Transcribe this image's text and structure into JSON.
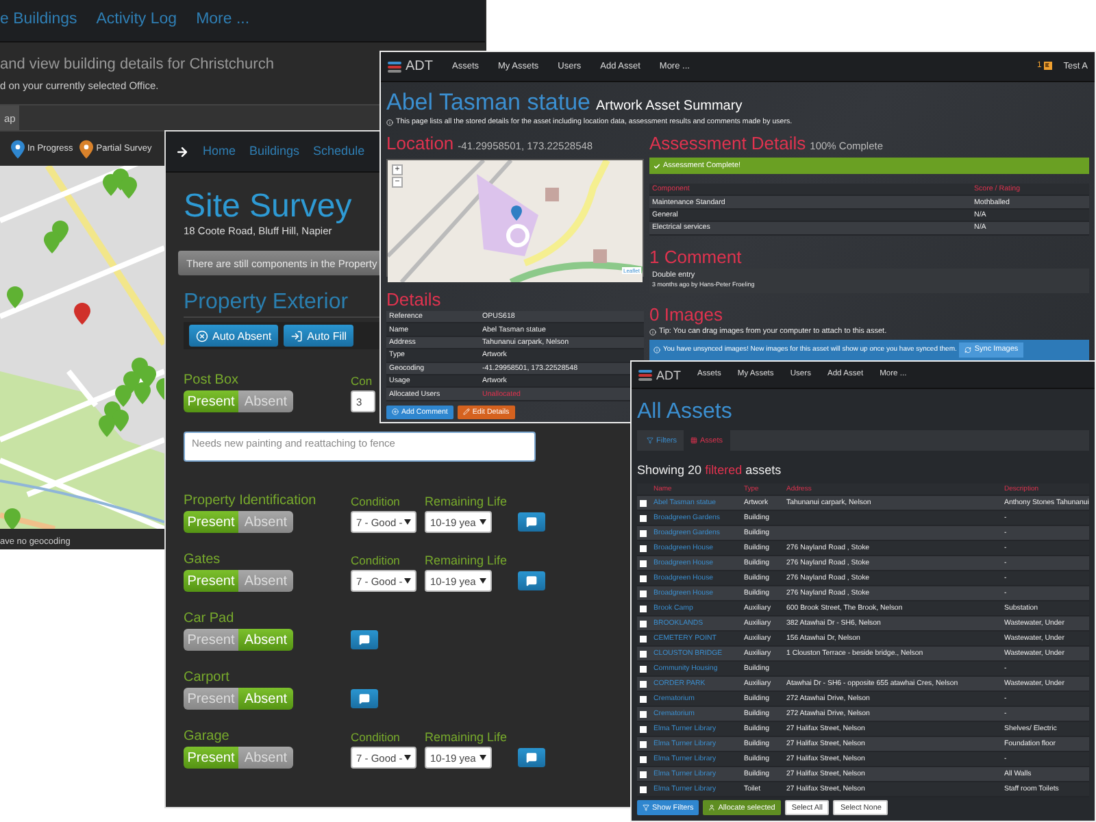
{
  "back_window": {
    "nav": [
      "e Buildings",
      "Activity Log",
      "More ..."
    ],
    "heading": "and view building details for Christchurch",
    "subheading": "d on your currently selected Office.",
    "tab": {
      "label": "ap",
      "selected": true
    },
    "legend": [
      {
        "label": "In Progress",
        "color": "#2f87d0"
      },
      {
        "label": "Partial Survey",
        "color": "#d9822b"
      }
    ],
    "footer": "ave no geocoding"
  },
  "site_survey": {
    "nav": [
      "Home",
      "Buildings",
      "Schedule"
    ],
    "title": "Site Survey",
    "address": "18 Coote Road, Bluff Hill, Napier",
    "alert": "There are still components in the Property",
    "section": "Property Exterior",
    "actions": [
      "Auto Absent",
      "Auto Fill"
    ],
    "components": [
      {
        "label": "Post Box",
        "options": [
          {
            "label": "Present",
            "selected": true
          },
          {
            "label": "Absent",
            "selected": false
          }
        ],
        "condition": {
          "label": "Con",
          "value": "3"
        },
        "notes": "Needs new painting and reattaching to fence",
        "comment": false
      },
      {
        "label": "Property Identification",
        "options": [
          {
            "label": "Present",
            "selected": true
          },
          {
            "label": "Absent",
            "selected": false
          }
        ],
        "condition": {
          "label": "Condition",
          "value": "7 - Good -"
        },
        "remaining_life": {
          "label": "Remaining Life",
          "value": "10-19 yea"
        },
        "comment": true
      },
      {
        "label": "Gates",
        "options": [
          {
            "label": "Present",
            "selected": true
          },
          {
            "label": "Absent",
            "selected": false
          }
        ],
        "condition": {
          "label": "Condition",
          "value": "7 - Good -"
        },
        "remaining_life": {
          "label": "Remaining Life",
          "value": "10-19 yea"
        },
        "comment": true
      },
      {
        "label": "Car Pad",
        "options": [
          {
            "label": "Present",
            "selected": false
          },
          {
            "label": "Absent",
            "selected": true
          }
        ],
        "comment": true
      },
      {
        "label": "Carport",
        "options": [
          {
            "label": "Present",
            "selected": false
          },
          {
            "label": "Absent",
            "selected": true
          }
        ],
        "comment": true
      },
      {
        "label": "Garage",
        "options": [
          {
            "label": "Present",
            "selected": true
          },
          {
            "label": "Absent",
            "selected": false
          }
        ],
        "condition": {
          "label": "Condition",
          "value": "7 - Good -"
        },
        "remaining_life": {
          "label": "Remaining Life",
          "value": "10-19 yea"
        },
        "comment": true
      }
    ]
  },
  "asset_summary": {
    "brand": "ADT",
    "nav": [
      "Assets",
      "My Assets",
      "Users",
      "Add Asset",
      "More ..."
    ],
    "notifications": "1",
    "user": "Test A",
    "title": "Abel Tasman statue",
    "subtitle": "Artwork Asset Summary",
    "info": "This page lists all the stored details for the asset including location data, assessment results and comments made by users.",
    "location": {
      "heading": "Location",
      "coords": "-41.29958501, 173.22528548",
      "zoom": [
        "+",
        "−"
      ],
      "attribution": "Leaflet"
    },
    "details": {
      "heading": "Details",
      "rows": [
        {
          "label": "Reference",
          "value": "OPUS618",
          "highlight": false
        },
        {
          "label": "Name",
          "value": "Abel Tasman statue",
          "highlight": false
        },
        {
          "label": "Address",
          "value": "Tahunanui carpark, Nelson",
          "highlight": false
        },
        {
          "label": "Type",
          "value": "Artwork",
          "highlight": false
        },
        {
          "label": "Geocoding",
          "value": "-41.29958501, 173.22528548",
          "highlight": false
        },
        {
          "label": "Usage",
          "value": "Artwork",
          "highlight": false
        },
        {
          "label": "Allocated Users",
          "value": "Unallocated",
          "highlight": true
        }
      ]
    },
    "buttons": [
      {
        "label": "Add Comment",
        "kind": "primary"
      },
      {
        "label": "Edit Details",
        "kind": "warning"
      }
    ],
    "assessment": {
      "heading": "Assessment Details",
      "progress": "100% Complete",
      "banner": "Assessment Complete!",
      "columns": [
        "Component",
        "Score / Rating"
      ],
      "rows": [
        [
          "Maintenance Standard",
          "Mothballed"
        ],
        [
          "General",
          "N/A"
        ],
        [
          "Electrical services",
          "N/A"
        ]
      ]
    },
    "comments": {
      "heading": "1 Comment",
      "items": [
        {
          "text": "Double entry",
          "meta": "3 months ago by Hans-Peter Froeling"
        }
      ]
    },
    "images": {
      "heading": "0 Images",
      "tip": "Tip: You can drag images from your computer to attach to this asset.",
      "alert": "You have unsynced images! New images for this asset will show up once you have synced them.",
      "sync_button": "Sync Images"
    }
  },
  "all_assets": {
    "brand": "ADT",
    "nav": [
      "Assets",
      "My Assets",
      "Users",
      "Add Asset",
      "More ..."
    ],
    "title": "All Assets",
    "tabs": [
      {
        "label": "Filters",
        "selected": false
      },
      {
        "label": "Assets",
        "selected": true
      }
    ],
    "summary": {
      "before": "Showing 20",
      "highlight": "filtered",
      "after": "assets"
    },
    "columns": [
      "Name",
      "Type",
      "Address",
      "Description"
    ],
    "rows": [
      {
        "checked": false,
        "name": "Abel Tasman statue",
        "type": "Artwork",
        "address": "Tahunanui carpark, Nelson",
        "description": "Anthony Stones Tahunanui"
      },
      {
        "checked": false,
        "name": "Broadgreen Gardens",
        "type": "Building",
        "description": "-"
      },
      {
        "checked": false,
        "name": "Broadgreen Gardens",
        "type": "Building",
        "description": "-"
      },
      {
        "checked": false,
        "name": "Broadgreen House",
        "type": "Building",
        "address": "276 Nayland Road , Stoke",
        "description": "-"
      },
      {
        "checked": false,
        "name": "Broadgreen House",
        "type": "Building",
        "address": "276 Nayland Road , Stoke",
        "description": "-"
      },
      {
        "checked": false,
        "name": "Broadgreen House",
        "type": "Building",
        "address": "276 Nayland Road , Stoke",
        "description": "-"
      },
      {
        "checked": false,
        "name": "Broadgreen House",
        "type": "Building",
        "address": "276 Nayland Road , Stoke",
        "description": "-"
      },
      {
        "checked": false,
        "name": "Brook Camp",
        "type": "Auxiliary",
        "address": "600 Brook Street, The Brook, Nelson",
        "description": "Substation"
      },
      {
        "checked": false,
        "name": "BROOKLANDS",
        "type": "Auxiliary",
        "address": "382 Atawhai Dr - SH6, Nelson",
        "description": "Wastewater, Under"
      },
      {
        "checked": false,
        "name": "CEMETERY POINT",
        "type": "Auxiliary",
        "address": "156 Atawhai Dr, Nelson",
        "description": "Wastewater, Under"
      },
      {
        "checked": false,
        "name": "CLOUSTON BRIDGE",
        "type": "Auxiliary",
        "address": "1 Clouston Terrace - beside bridge., Nelson",
        "description": "Wastewater, Under"
      },
      {
        "checked": false,
        "name": "Community Housing",
        "type": "Building",
        "description": "-"
      },
      {
        "checked": false,
        "name": "CORDER PARK",
        "type": "Auxiliary",
        "address": "Atawhai Dr - SH6 - opposite 655 atawhai Cres, Nelson",
        "description": "Wastewater, Under"
      },
      {
        "checked": false,
        "name": "Crematorium",
        "type": "Building",
        "address": "272 Atawhai Drive, Nelson",
        "description": "-"
      },
      {
        "checked": false,
        "name": "Crematorium",
        "type": "Building",
        "address": "272 Atawhai Drive, Nelson",
        "description": "-"
      },
      {
        "checked": false,
        "name": "Elma Turner Library",
        "type": "Building",
        "address": "27 Halifax Street, Nelson",
        "description": "Shelves/ Electric"
      },
      {
        "checked": false,
        "name": "Elma Turner Library",
        "type": "Building",
        "address": "27 Halifax Street, Nelson",
        "description": "Foundation floor"
      },
      {
        "checked": false,
        "name": "Elma Turner Library",
        "type": "Building",
        "address": "27 Halifax Street, Nelson",
        "description": "-"
      },
      {
        "checked": false,
        "name": "Elma Turner Library",
        "type": "Building",
        "address": "27 Halifax Street, Nelson",
        "description": "All Walls"
      },
      {
        "checked": false,
        "name": "Elma Turner Library",
        "type": "Toilet",
        "address": "27 Halifax Street, Nelson",
        "description": "Staff room Toilets"
      }
    ],
    "buttons": [
      {
        "label": "Show Filters",
        "kind": "primary"
      },
      {
        "label": "Allocate selected",
        "kind": "success"
      },
      {
        "label": "Select All",
        "kind": "default"
      },
      {
        "label": "Select None",
        "kind": "default"
      }
    ]
  }
}
